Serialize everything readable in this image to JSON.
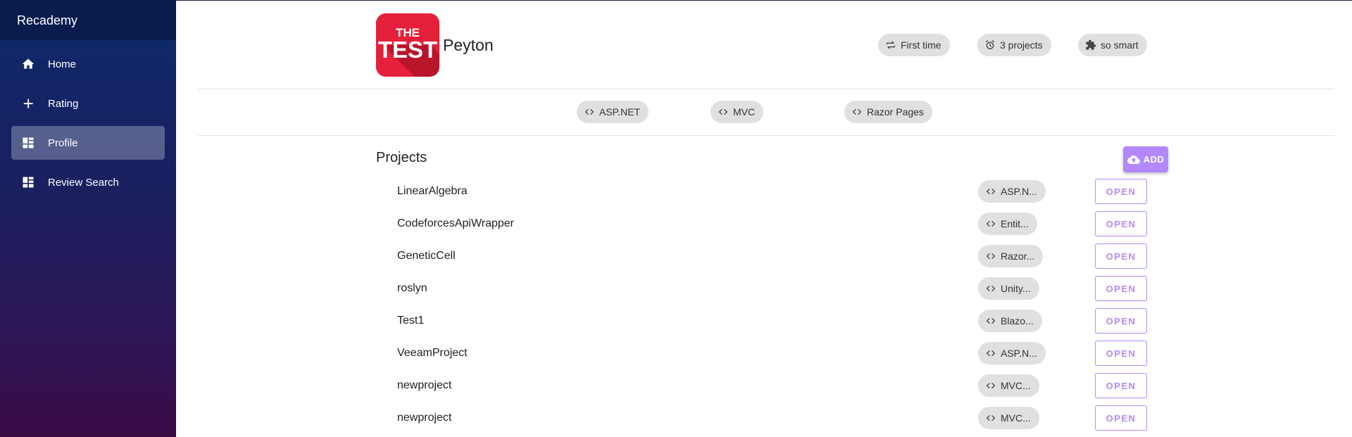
{
  "app": {
    "brand": "Recademy"
  },
  "sidebar": {
    "items": [
      {
        "label": "Home",
        "icon": "home-icon"
      },
      {
        "label": "Rating",
        "icon": "plus-icon"
      },
      {
        "label": "Profile",
        "icon": "dashboard-icon",
        "active": true
      },
      {
        "label": "Review Search",
        "icon": "dashboard-icon"
      }
    ]
  },
  "profile": {
    "logo_top": "THE",
    "logo_main": "TEST",
    "name": "Peyton",
    "badges": [
      {
        "label": "First time",
        "icon": "repeat-icon"
      },
      {
        "label": "3 projects",
        "icon": "alarm-icon"
      },
      {
        "label": "so smart",
        "icon": "puzzle-icon"
      }
    ],
    "skills": [
      "ASP.NET",
      "MVC",
      "Razor Pages"
    ]
  },
  "projects": {
    "title": "Projects",
    "add_label": "ADD",
    "open_label": "OPEN",
    "items": [
      {
        "name": "LinearAlgebra",
        "tag": "ASP.N..."
      },
      {
        "name": "CodeforcesApiWrapper",
        "tag": "Entit..."
      },
      {
        "name": "GeneticCell",
        "tag": "Razor..."
      },
      {
        "name": "roslyn",
        "tag": "Unity..."
      },
      {
        "name": "Test1",
        "tag": "Blazo..."
      },
      {
        "name": "VeeamProject",
        "tag": "ASP.N..."
      },
      {
        "name": "newproject",
        "tag": "MVC..."
      },
      {
        "name": "newproject",
        "tag": "MVC..."
      }
    ]
  },
  "colors": {
    "accent": "#b388ff",
    "logo": "#e5203a",
    "sidebar_top": "#0a1b4d"
  }
}
